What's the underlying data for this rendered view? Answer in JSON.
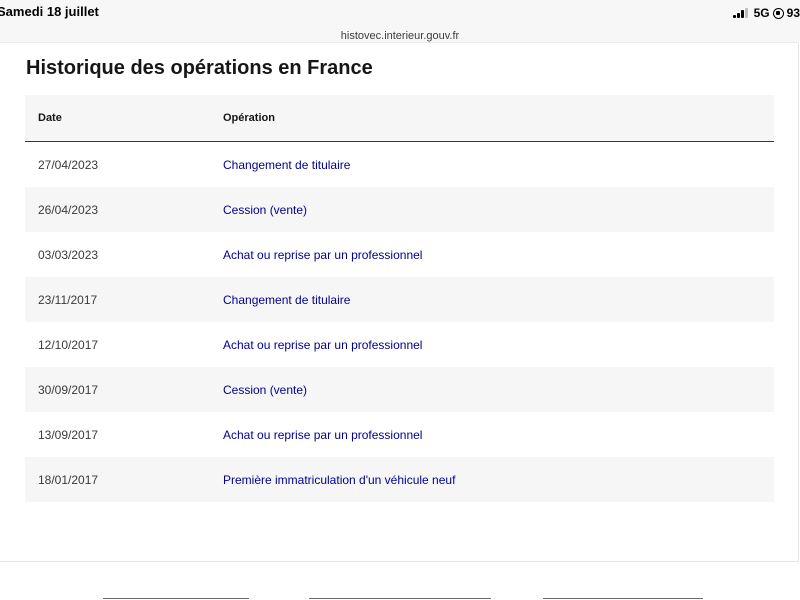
{
  "status_bar": {
    "date": "Samedi 18 juillet",
    "network": "5G",
    "battery": "93"
  },
  "browser": {
    "url": "histovec.interieur.gouv.fr"
  },
  "page": {
    "title": "Historique des opérations en France",
    "table": {
      "headers": {
        "date": "Date",
        "operation": "Opération"
      },
      "rows": [
        {
          "date": "27/04/2023",
          "operation": "Changement de titulaire"
        },
        {
          "date": "26/04/2023",
          "operation": "Cession (vente)"
        },
        {
          "date": "03/03/2023",
          "operation": "Achat ou reprise par un professionnel"
        },
        {
          "date": "23/11/2017",
          "operation": "Changement de titulaire"
        },
        {
          "date": "12/10/2017",
          "operation": "Achat ou reprise par un professionnel"
        },
        {
          "date": "30/09/2017",
          "operation": "Cession (vente)"
        },
        {
          "date": "13/09/2017",
          "operation": "Achat ou reprise par un professionnel"
        },
        {
          "date": "18/01/2017",
          "operation": "Première immatriculation d'un véhicule neuf"
        }
      ]
    }
  },
  "colors": {
    "link": "#000091",
    "row_alt": "#f6f6f6"
  },
  "icons": [
    "signal-icon",
    "orientation-lock-icon"
  ]
}
